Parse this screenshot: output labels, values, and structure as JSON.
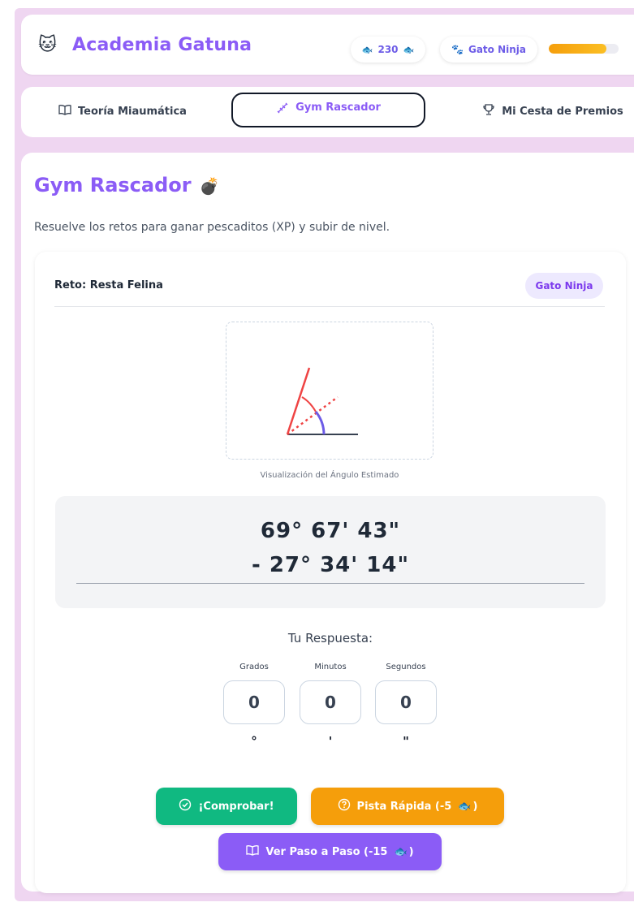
{
  "header": {
    "brand_emoji": "🐱",
    "title": "Academia Gatuna",
    "xp_value": "230",
    "xp_icon": "fish-icon",
    "rank_icon": "paw-icon",
    "rank_label": "Gato Ninja",
    "level_progress": 0.82,
    "colors": {
      "brand": "#8b5cf6",
      "progress": "#f59e0b"
    }
  },
  "tabs": [
    {
      "label": "Teoría Miaumática",
      "icon": "book-icon",
      "active": false
    },
    {
      "label": "Gym Rascador",
      "icon": "dumbbell-icon",
      "active": true
    },
    {
      "label": "Mi Cesta de Premios",
      "icon": "trophy-icon",
      "active": false
    }
  ],
  "main": {
    "title": "Gym Rascador",
    "title_icon": "bomb-icon",
    "subtitle": "Resuelve los retos para ganar pescaditos (XP) y subir de nivel.",
    "challenge": {
      "title": "Reto: Resta Felina",
      "level_badge": "Gato Ninja",
      "angle_caption": "Visualización del Ángulo Estimado",
      "line1": "69° 67' 43\"",
      "line2": "- 27° 34' 14\""
    },
    "answer": {
      "title": "Tu Respuesta:",
      "fields": [
        {
          "label": "Grados",
          "value": "0",
          "unit": "°"
        },
        {
          "label": "Minutos",
          "value": "0",
          "unit": "'"
        },
        {
          "label": "Segundos",
          "value": "0",
          "unit": "\""
        }
      ]
    },
    "buttons": {
      "check": "¡Comprobar!",
      "hint": "Pista Rápida (-5",
      "steps": "Ver Paso a Paso (-15",
      "close_paren": ")"
    },
    "colors": {
      "check": "#10b981",
      "hint": "#f59e0b",
      "steps": "#8b5cf6"
    }
  }
}
